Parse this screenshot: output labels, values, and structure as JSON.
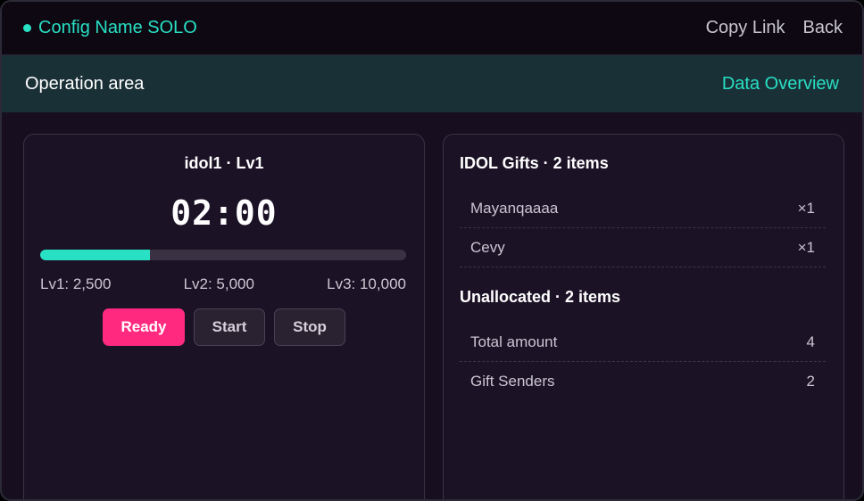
{
  "header": {
    "title": "Config Name SOLO",
    "copy_link": "Copy Link",
    "back": "Back"
  },
  "operation_bar": {
    "label": "Operation area",
    "data_overview": "Data Overview"
  },
  "idol_panel": {
    "name": "idol1 · Lv1",
    "timer": "02:00",
    "progress_percent": 30,
    "levels": [
      "Lv1: 2,500",
      "Lv2: 5,000",
      "Lv3: 10,000"
    ],
    "buttons": {
      "ready": "Ready",
      "start": "Start",
      "stop": "Stop"
    }
  },
  "gifts_panel": {
    "idol_gifts_title": "IDOL Gifts · 2 items",
    "idol_gifts": [
      {
        "name": "Mayanqaaaa",
        "value": "×1"
      },
      {
        "name": "Cevy",
        "value": "×1"
      }
    ],
    "unallocated_title": "Unallocated · 2 items",
    "unallocated": [
      {
        "name": "Total amount",
        "value": "4"
      },
      {
        "name": "Gift Senders",
        "value": "2"
      }
    ]
  },
  "colors": {
    "accent": "#28e0c4",
    "ready": "#ff2a7f",
    "background": "#170f1f"
  }
}
